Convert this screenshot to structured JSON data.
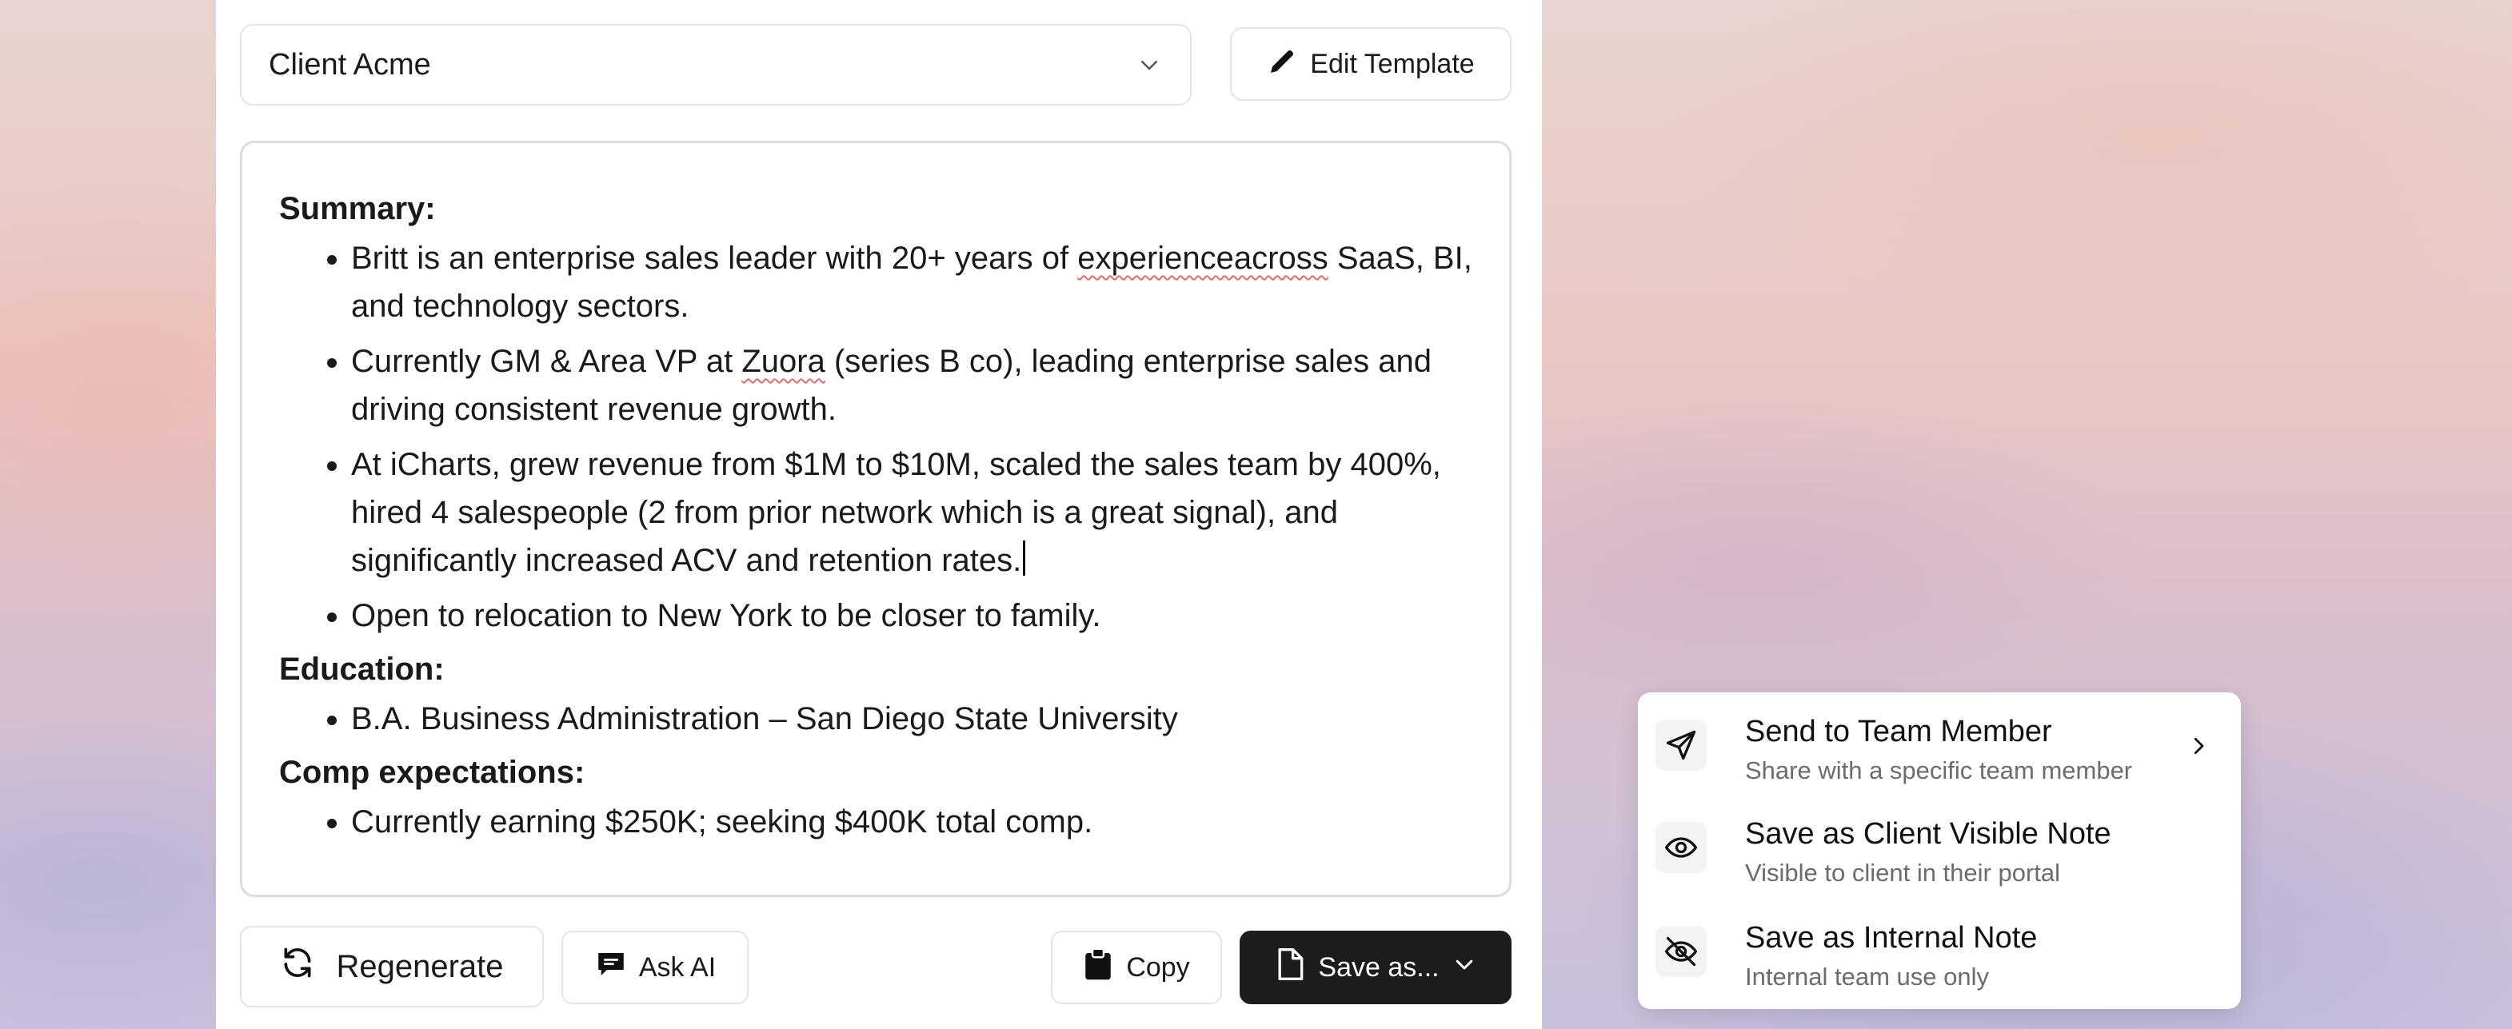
{
  "client_select": {
    "value": "Client Acme",
    "icon": "chevron-down-icon"
  },
  "edit_template": {
    "label": "Edit Template",
    "icon": "pencil-icon"
  },
  "editor": {
    "summary_heading": "Summary:",
    "summary_items": [
      {
        "before": "Britt is an enterprise sales leader with 20+ years of ",
        "flagged": "experienceacross",
        "after": " SaaS, BI, and technology sectors."
      },
      {
        "before": "Currently GM & Area VP at ",
        "flagged": "Zuora",
        "after": " (series B co), leading enterprise sales and driving consistent revenue growth."
      },
      {
        "before": "At iCharts, grew revenue from $1M to $10M, scaled the sales team by 400%, hired 4 salespeople (2 from prior network which is a great signal), and significantly increased ACV and retention rates.",
        "flagged": "",
        "after": ""
      },
      {
        "before": "Open to relocation to New York to be closer to family.",
        "flagged": "",
        "after": ""
      }
    ],
    "education_heading": "Education:",
    "education_items": [
      "B.A. Business Administration – San Diego State University"
    ],
    "comp_heading": "Comp expectations:",
    "comp_items": [
      "Currently earning $250K; seeking $400K total comp."
    ]
  },
  "actions": {
    "regenerate": {
      "label": "Regenerate",
      "icon": "refresh-icon"
    },
    "ask_ai": {
      "label": "Ask AI",
      "icon": "chat-icon"
    },
    "copy": {
      "label": "Copy",
      "icon": "clipboard-icon"
    },
    "save_as": {
      "label": "Save as...",
      "icon": "file-icon",
      "dropdown_icon": "chevron-down-icon"
    }
  },
  "save_menu": {
    "items": [
      {
        "title": "Send to Team Member",
        "subtitle": "Share with a specific team member",
        "icon": "send-icon",
        "has_submenu": true
      },
      {
        "title": "Save as Client Visible Note",
        "subtitle": "Visible to client in their portal",
        "icon": "eye-icon",
        "has_submenu": false
      },
      {
        "title": "Save as Internal Note",
        "subtitle": "Internal team use only",
        "icon": "eye-off-icon",
        "has_submenu": false
      }
    ]
  },
  "colors": {
    "primary_button": "#1c1c1e",
    "border": "#e4e4e7",
    "muted_text": "#6b6b70",
    "spellcheck": "#e06b6b"
  }
}
